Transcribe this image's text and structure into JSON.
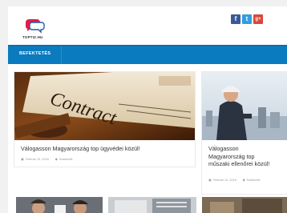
{
  "site": {
    "logo_text": "TOPTIZ.HU"
  },
  "social": [
    {
      "name": "facebook",
      "glyph": "f",
      "color": "#3b5998"
    },
    {
      "name": "twitter",
      "glyph": "t",
      "color": "#2f9fe0"
    },
    {
      "name": "google-plus",
      "glyph": "g+",
      "color": "#d9473b"
    }
  ],
  "nav": {
    "item": "BEFEKTETÉS"
  },
  "cards": [
    {
      "title": "Válogasson Magyarország top ügyvédei közül!",
      "date": "Február 13, 2018",
      "tag": "Szakértők",
      "image_text": "Contract"
    },
    {
      "title_lines": [
        "Válogasson",
        "Magyarország top",
        "műszaki ellenőrei közül!"
      ],
      "date": "Február 13, 2018",
      "tag": "Szakértők"
    }
  ]
}
